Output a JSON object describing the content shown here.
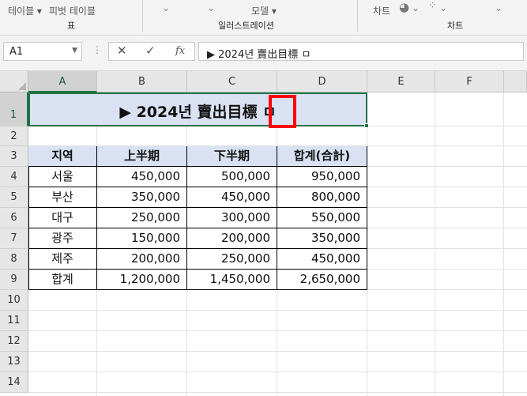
{
  "ribbon": {
    "labels": [
      "테이블 ▾",
      "피벗 테이블",
      "모델 ▾",
      "차트"
    ],
    "groups": [
      "표",
      "일러스트레이션",
      "차트"
    ]
  },
  "formula_bar": {
    "name_box": "A1",
    "content": "▶ 2024년 賣出目標 ㅁ"
  },
  "columns": [
    "A",
    "B",
    "C",
    "D",
    "E",
    "F"
  ],
  "rows": [
    "1",
    "2",
    "3",
    "4",
    "5",
    "6",
    "7",
    "8",
    "9",
    "10",
    "11",
    "12",
    "13",
    "14"
  ],
  "title_cell": "▶ 2024년 賣出目標 ㅁ",
  "table": {
    "headers": [
      "지역",
      "上半期",
      "下半期",
      "합계(合計)"
    ],
    "rows": [
      [
        "서울",
        "450,000",
        "500,000",
        "950,000"
      ],
      [
        "부산",
        "350,000",
        "450,000",
        "800,000"
      ],
      [
        "대구",
        "250,000",
        "300,000",
        "550,000"
      ],
      [
        "광주",
        "150,000",
        "200,000",
        "350,000"
      ],
      [
        "제주",
        "200,000",
        "250,000",
        "450,000"
      ],
      [
        "합계",
        "1,200,000",
        "1,450,000",
        "2,650,000"
      ]
    ]
  },
  "colors": {
    "accent": "#217346",
    "header_fill": "#d9e1f2",
    "highlight": "#ff0000"
  }
}
